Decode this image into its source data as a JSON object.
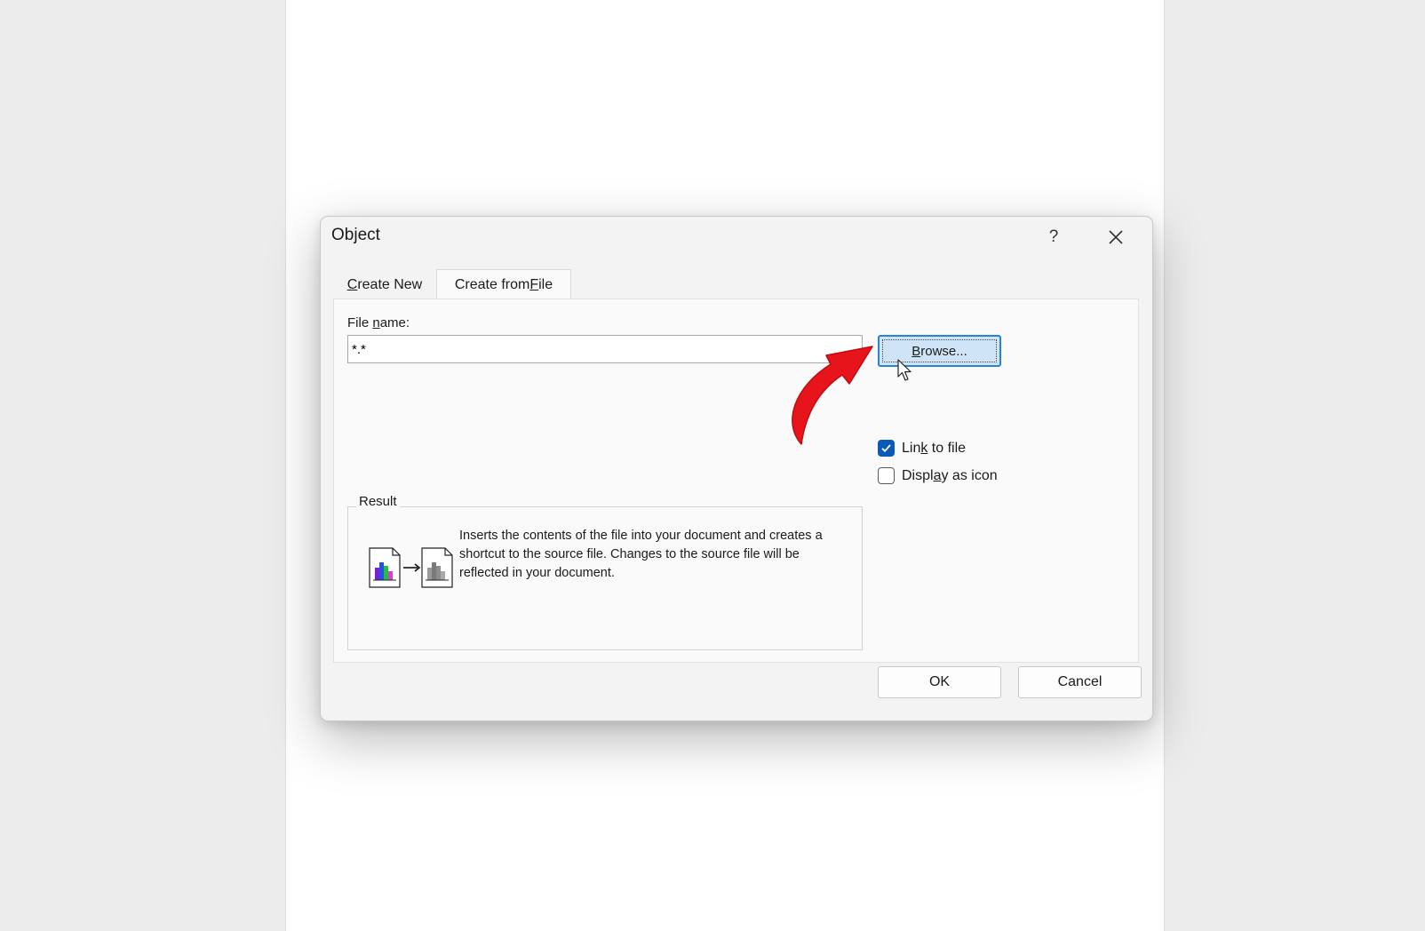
{
  "dialog": {
    "title": "Object",
    "help_label": "?",
    "tabs": [
      {
        "label_pre": "",
        "label_u": "C",
        "label_post": "reate New"
      },
      {
        "label_pre": "Create from ",
        "label_u": "F",
        "label_post": "ile"
      }
    ],
    "file_name_label_pre": "File ",
    "file_name_label_u": "n",
    "file_name_label_post": "ame:",
    "file_name_value": "*.*",
    "browse_pre": "",
    "browse_u": "B",
    "browse_post": "rowse...",
    "link_to_file": {
      "pre": "Lin",
      "u": "k",
      "post": " to file",
      "checked": true
    },
    "display_as_icon": {
      "pre": "Displ",
      "u": "a",
      "post": "y as icon",
      "checked": false
    },
    "result_label": "Result",
    "result_text": "Inserts the contents of the file into your document and creates a shortcut to the source file.  Changes to the source file will be reflected in your document.",
    "ok_label": "OK",
    "cancel_label": "Cancel"
  },
  "colors": {
    "accent": "#0a5bb5",
    "browse_focus_bg": "#cfe5f7",
    "browse_border": "#2b84d0",
    "annotation_arrow": "#e8141b"
  },
  "icons": [
    "close-icon",
    "checkmark-icon",
    "chart-file-icon",
    "arrow-right-icon",
    "shortcut-file-icon",
    "mouse-cursor-icon",
    "red-annotation-arrow-icon"
  ]
}
